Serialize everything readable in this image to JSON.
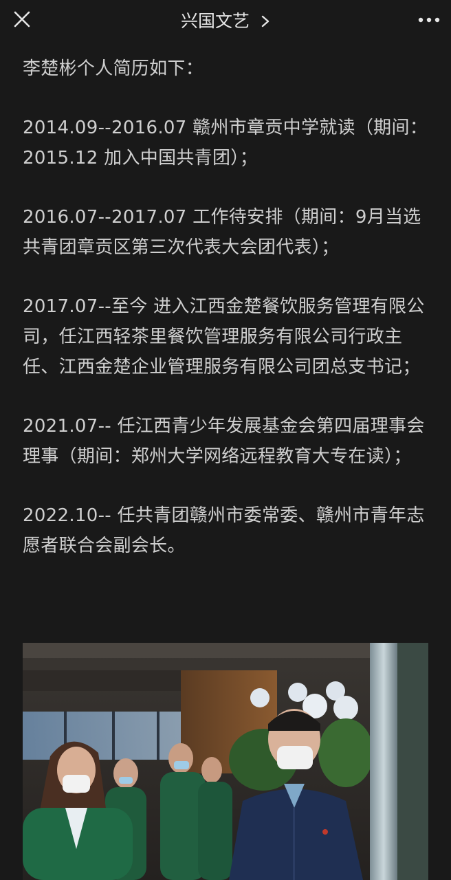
{
  "header": {
    "title": "兴国文艺"
  },
  "article": {
    "paragraphs": [
      "李楚彬个人简历如下：",
      "2014.09--2016.07 赣州市章贡中学就读（期间：2015.12 加入中国共青团）；",
      "2016.07--2017.07 工作待安排（期间：9月当选共青团章贡区第三次代表大会团代表）；",
      "2017.07--至今 进入江西金楚餐饮服务管理有限公司，任江西轻茶里餐饮管理服务有限公司行政主任、江西金楚企业管理服务有限公司团总支书记；",
      "2021.07-- 任江西青少年发展基金会第四届理事会理事（期间：郑州大学网络远程教育大专在读）；",
      "2022.10-- 任共青团赣州市委常委、赣州市青年志愿者联合会副会长。"
    ]
  },
  "colors": {
    "background": "#191919",
    "text": "#cfcfcf",
    "title": "#e6e6e6"
  },
  "icons": {
    "close": "close-icon",
    "chevron": "chevron-right-icon",
    "more": "more-dots-icon"
  }
}
